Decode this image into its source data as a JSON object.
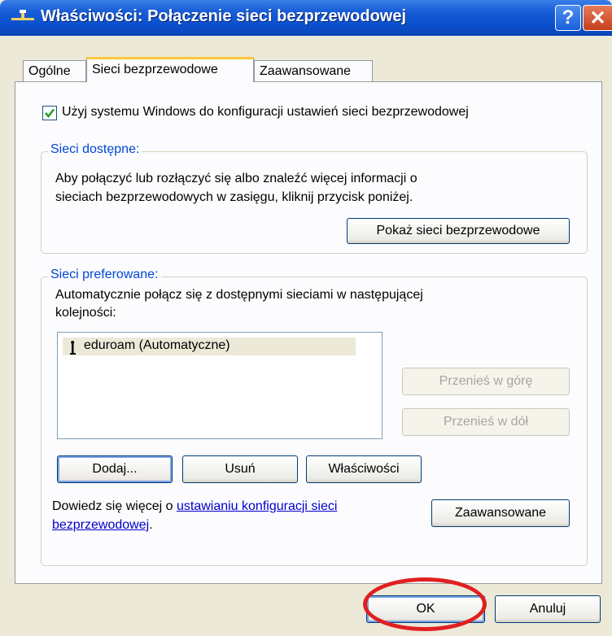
{
  "window": {
    "title": "Właściwości: Połączenie sieci bezprzewodowej",
    "help_label": "?",
    "close_label": "✕"
  },
  "tabs": [
    {
      "label": "Ogólne"
    },
    {
      "label": "Sieci bezprzewodowe"
    },
    {
      "label": "Zaawansowane"
    }
  ],
  "use_windows_checkbox": {
    "checked": true,
    "label": "Użyj systemu Windows do konfiguracji ustawień sieci bezprzewodowej"
  },
  "available_networks": {
    "legend": "Sieci dostępne:",
    "description_line1": "Aby połączyć lub rozłączyć się albo znaleźć więcej informacji o",
    "description_line2": "sieciach bezprzewodowych w zasięgu, kliknij przycisk poniżej.",
    "show_button": "Pokaż sieci bezprzewodowe"
  },
  "preferred_networks": {
    "legend": "Sieci preferowane:",
    "description_line1": "Automatycznie połącz się z dostępnymi sieciami w następującej",
    "description_line2": "kolejności:",
    "items": [
      {
        "label": "eduroam (Automatyczne)"
      }
    ],
    "move_up_button": "Przenieś w górę",
    "move_down_button": "Przenieś w dół",
    "add_button": "Dodaj...",
    "remove_button": "Usuń",
    "properties_button": "Właściwości",
    "learn_more_prefix": "Dowiedz się więcej o",
    "learn_more_link_line1": "ustawianiu konfiguracji sieci",
    "learn_more_link_line2": "bezprzewodowej",
    "learn_more_suffix": ".",
    "advanced_button": "Zaawansowane"
  },
  "footer": {
    "ok_button": "OK",
    "cancel_button": "Anuluj"
  },
  "colors": {
    "title_bar": "#0a4fcc",
    "legend_text": "#0046d5",
    "annotation": "#e02020"
  }
}
